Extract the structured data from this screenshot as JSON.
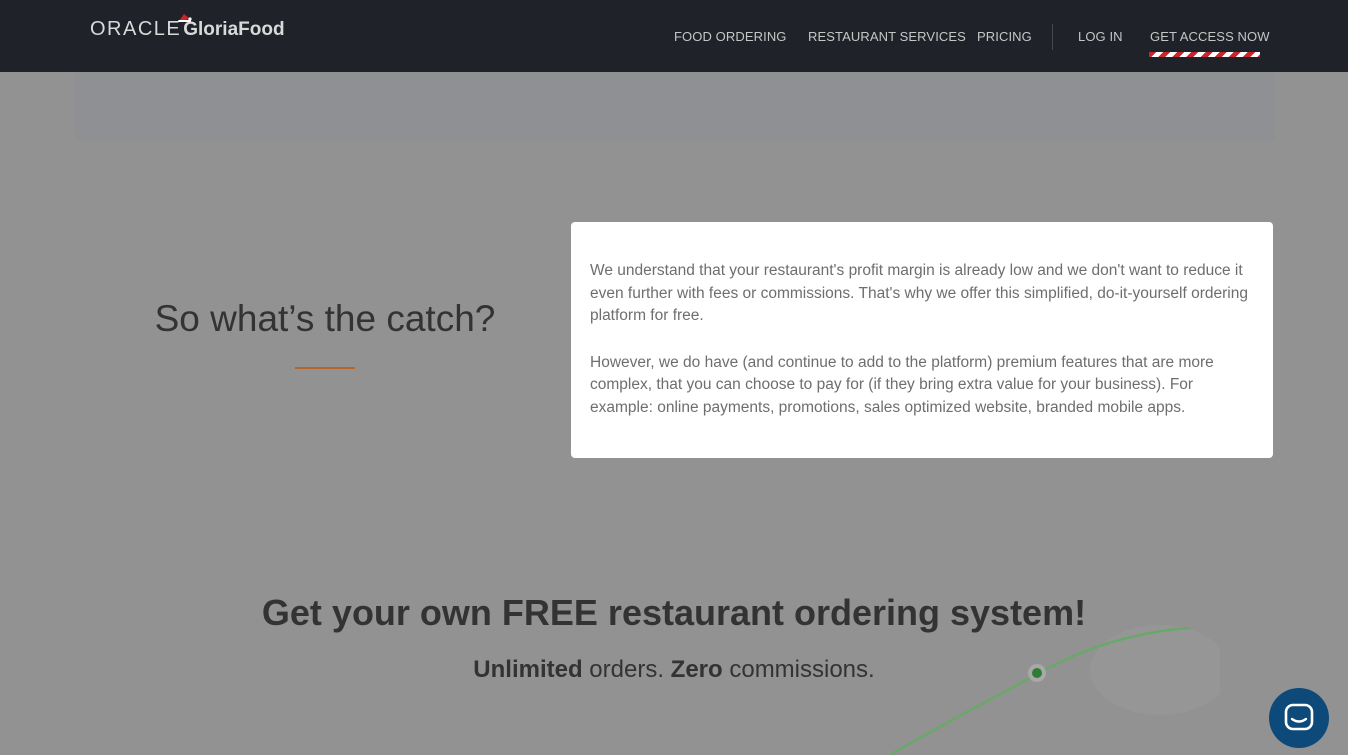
{
  "brand": {
    "oracle": "ORACLE",
    "gloria": "GloriaFood"
  },
  "nav": {
    "items": [
      {
        "label": "FOOD ORDERING"
      },
      {
        "label": "RESTAURANT SERVICES"
      },
      {
        "label": "PRICING"
      },
      {
        "label": "LOG IN"
      },
      {
        "label": "GET ACCESS NOW"
      }
    ]
  },
  "catch": {
    "title": "So what’s the catch?",
    "paragraphs": [
      "We understand that your restaurant's profit margin is already low and we don't want to reduce it even further with fees or commissions. That's why we offer this simplified, do-it-yourself ordering platform for free.",
      "However, we do have (and continue to add to the platform) premium features that are more complex, that you can choose to pay for (if they bring extra value for your business). For example: online payments, promotions, sales optimized website, branded mobile apps."
    ]
  },
  "cta": {
    "title": "Get your own FREE restaurant ordering system!",
    "sub_bold_1": "Unlimited",
    "sub_text_1": " orders. ",
    "sub_bold_2": "Zero",
    "sub_text_2": " commissions."
  },
  "chat": {
    "icon": "chat-bubble-icon"
  },
  "colors": {
    "nav_bg": "#1f2229",
    "accent_underline": "#b5652a",
    "chat_button": "#0d4a79",
    "stripe_red": "#c9252c"
  }
}
